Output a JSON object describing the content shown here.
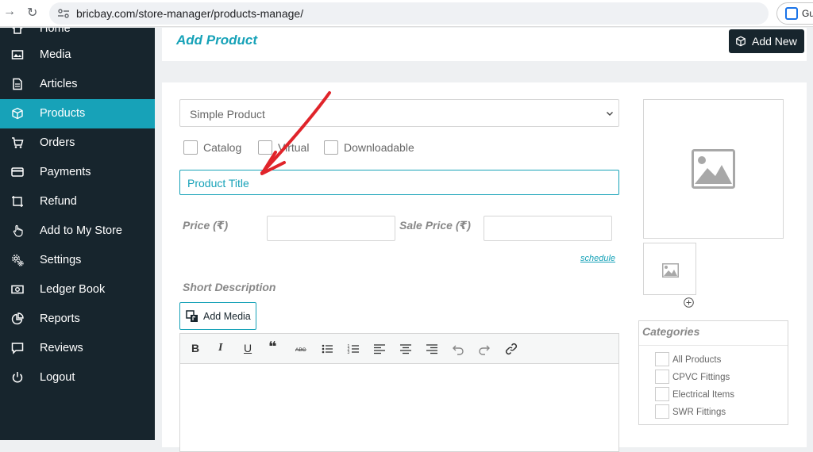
{
  "browser": {
    "url": "bricbay.com/store-manager/products-manage/",
    "profile_label": "Gue"
  },
  "sidebar": {
    "items": [
      {
        "label": "Home",
        "icon": "home-icon"
      },
      {
        "label": "Media",
        "icon": "image-icon"
      },
      {
        "label": "Articles",
        "icon": "document-icon"
      },
      {
        "label": "Products",
        "icon": "cube-icon",
        "active": true
      },
      {
        "label": "Orders",
        "icon": "cart-icon"
      },
      {
        "label": "Payments",
        "icon": "credit-card-icon"
      },
      {
        "label": "Refund",
        "icon": "refund-icon"
      },
      {
        "label": "Add to My Store",
        "icon": "hand-pointer-icon"
      },
      {
        "label": "Settings",
        "icon": "gear-icon"
      },
      {
        "label": "Ledger Book",
        "icon": "money-icon"
      },
      {
        "label": "Reports",
        "icon": "pie-chart-icon"
      },
      {
        "label": "Reviews",
        "icon": "comment-icon"
      },
      {
        "label": "Logout",
        "icon": "power-icon"
      }
    ],
    "active_color": "#17a2b8",
    "background": "#17252d"
  },
  "header": {
    "title": "Add Product",
    "add_new_label": "Add New"
  },
  "form": {
    "product_type": "Simple Product",
    "checkboxes": {
      "catalog": "Catalog",
      "virtual": "Virtual",
      "downloadable": "Downloadable"
    },
    "title_placeholder": "Product Title",
    "price_label": "Price (₹)",
    "sale_price_label": "Sale Price (₹)",
    "schedule_label": "schedule",
    "short_description_label": "Short Description",
    "add_media_label": "Add Media"
  },
  "categories": {
    "title": "Categories",
    "items": [
      "All Products",
      "CPVC Fittings",
      "Electrical Items",
      "SWR Fittings"
    ]
  },
  "annotation": {
    "arrow_color": "#e0242a"
  }
}
